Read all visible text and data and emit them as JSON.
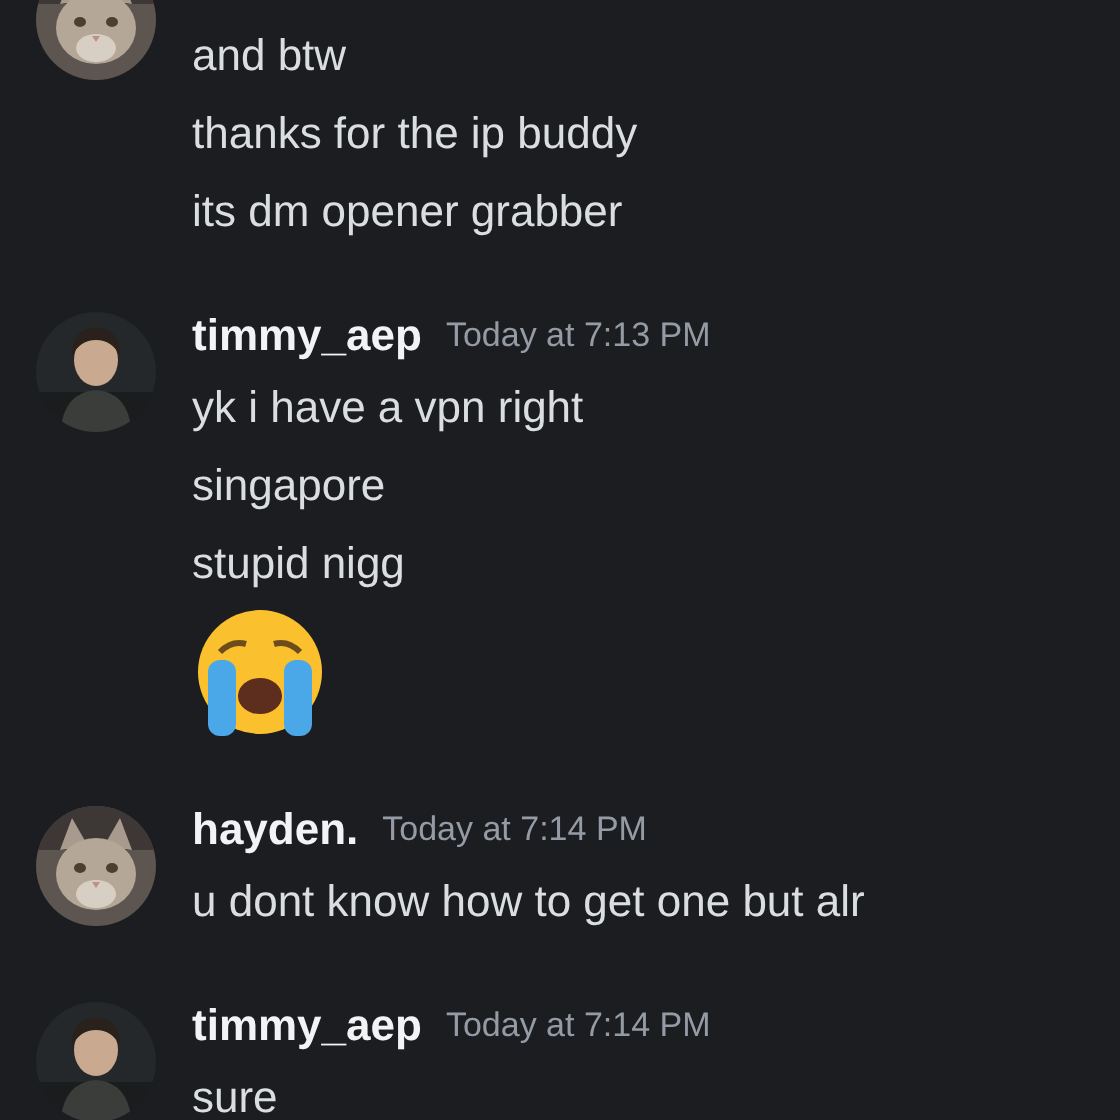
{
  "messages": [
    {
      "avatar": {
        "kind": "cat"
      },
      "lines": [
        {
          "kind": "text",
          "text": "and btw"
        },
        {
          "kind": "text",
          "text": "thanks for the ip buddy"
        },
        {
          "kind": "text",
          "text": "its dm opener grabber"
        }
      ]
    },
    {
      "author": "timmy_aep",
      "time": "Today at 7:13 PM",
      "avatar": {
        "kind": "person"
      },
      "lines": [
        {
          "kind": "text",
          "text": "yk i have a vpn right"
        },
        {
          "kind": "text",
          "text": "singapore"
        },
        {
          "kind": "text",
          "text": "stupid nigg"
        },
        {
          "kind": "emoji"
        }
      ]
    },
    {
      "author": "hayden.",
      "time": "Today at 7:14 PM",
      "avatar": {
        "kind": "cat"
      },
      "lines": [
        {
          "kind": "text",
          "text": "u dont know how to get one but alr"
        }
      ]
    },
    {
      "author": "timmy_aep",
      "time": "Today at 7:14 PM",
      "avatar": {
        "kind": "person"
      },
      "lines": [
        {
          "kind": "text",
          "text": "sure"
        }
      ]
    }
  ]
}
